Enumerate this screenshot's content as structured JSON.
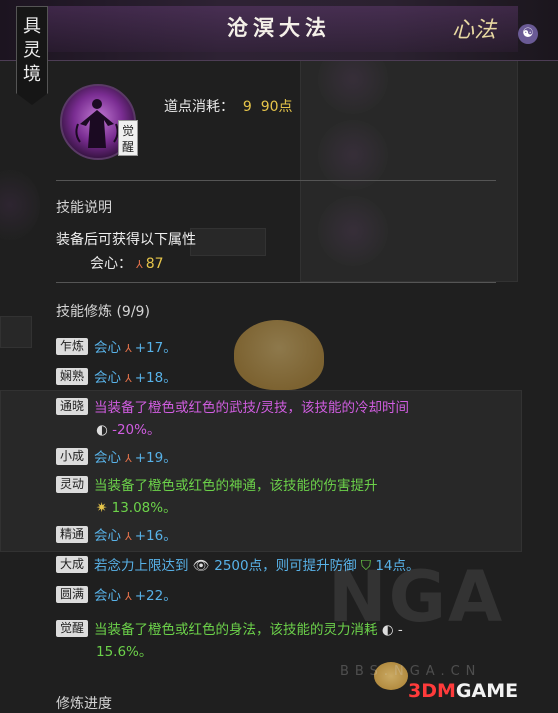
{
  "header": {
    "title": "沧溟大法",
    "school_logo_text": "心法",
    "realm_badge": "具灵境"
  },
  "skill": {
    "awaken_tag": "觉醒",
    "cost_label": "道点消耗：",
    "cost_value": "90点"
  },
  "description": {
    "title": "技能说明",
    "text": "装备后可获得以下属性",
    "crit_label": "会心：",
    "crit_value": "87"
  },
  "cultivation": {
    "title": "技能修炼 (9/9)",
    "rows": [
      {
        "tag": "乍炼",
        "text": "会心",
        "value": "+17。",
        "color": "blue"
      },
      {
        "tag": "娴熟",
        "text": "会心",
        "value": "+18。",
        "color": "blue"
      },
      {
        "tag": "通晓",
        "text": "当装备了橙色或红色的武技/灵技，该技能的冷却时间",
        "cont": "-20%。",
        "color": "pink"
      },
      {
        "tag": "小成",
        "text": "会心",
        "value": "+19。",
        "color": "blue"
      },
      {
        "tag": "灵动",
        "text": "当装备了橙色或红色的神通，该技能的伤害提升",
        "cont": "13.08%。",
        "color": "green"
      },
      {
        "tag": "精通",
        "text": "会心",
        "value": "+16。",
        "color": "blue"
      },
      {
        "tag": "大成",
        "text": "若念力上限达到",
        "mid": "2500点，则可提升防御",
        "end": "14点。",
        "color": "blue"
      },
      {
        "tag": "圆满",
        "text": "会心",
        "value": "+22。",
        "color": "blue"
      },
      {
        "tag": "觉醒",
        "text": "当装备了橙色或红色的身法，该技能的灵力消耗",
        "cont": "15.6%。",
        "color": "green"
      }
    ]
  },
  "progress_title": "修炼进度",
  "watermarks": {
    "nga": "NGA",
    "bbs": "BBS.NGA.CN",
    "brand_prefix": "3DM",
    "brand_suffix": "GAME"
  },
  "colors": {
    "blue": "#58b2e8",
    "pink": "#d05de0",
    "green": "#6cd24a",
    "gold": "#e6c54a",
    "header": "#2e2234"
  }
}
